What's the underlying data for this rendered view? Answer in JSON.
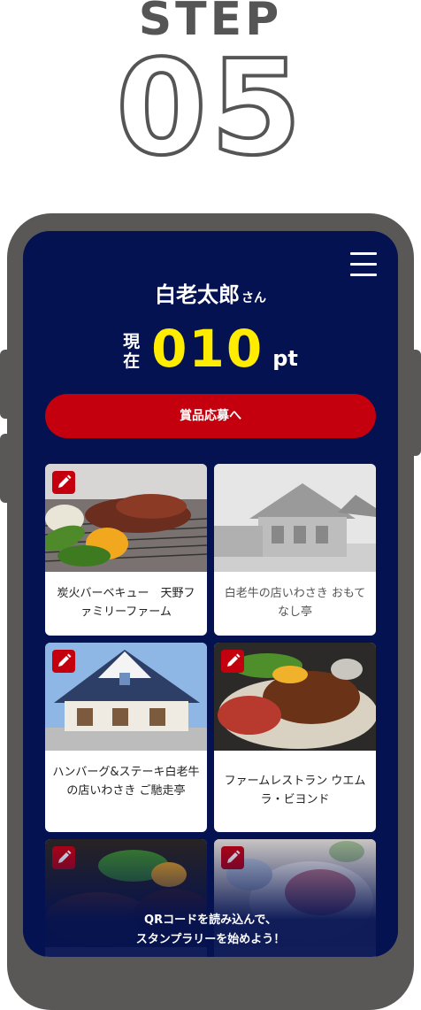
{
  "header": {
    "step_label": "STEP",
    "step_number": "05"
  },
  "user": {
    "name": "白老太郎",
    "suffix": "さん"
  },
  "points": {
    "current_label": "現在",
    "value": "010",
    "unit": "pt"
  },
  "prize_button": {
    "label": "賞品応募へ"
  },
  "stores": [
    {
      "title": "炭火バーベキュー　天野ファミリーファーム",
      "icon": "pencil-icon"
    },
    {
      "title": "白老牛の店いわさき おもてなし亭",
      "icon": "pencil-icon"
    },
    {
      "title": "ハンバーグ&ステーキ白老牛の店いわさき ご馳走亭",
      "icon": "pencil-icon"
    },
    {
      "title": "ファームレストラン ウエムラ・ビヨンド",
      "icon": "pencil-icon"
    },
    {
      "title": "",
      "icon": "pencil-icon"
    },
    {
      "title": "",
      "icon": "pencil-icon"
    }
  ],
  "footer": {
    "line1": "QRコードを読み込んで、",
    "line2": "スタンプラリーを始めよう！"
  },
  "colors": {
    "navy": "#041251",
    "red": "#c4000e",
    "yellow": "#ffec00",
    "frame": "#5a5757"
  }
}
